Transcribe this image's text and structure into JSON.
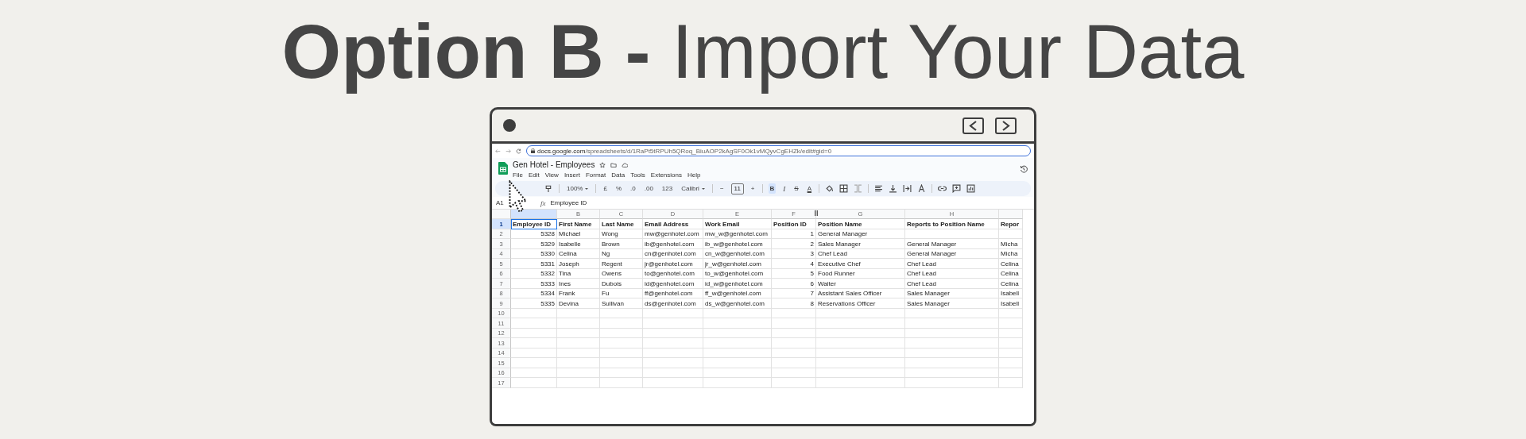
{
  "title": "**Option B -** Import Your Data",
  "browser": {
    "url_host": "docs.google.com",
    "url_path": "/spreadsheets/d/1RaPt5tRPUh5QRoq_BiuAOP2kAgSF0Ok1vMQyvCgEHZk/edit#gid=0"
  },
  "sheet": {
    "title": "Gen Hotel - Employees",
    "menus": [
      "File",
      "Edit",
      "View",
      "Insert",
      "Format",
      "Data",
      "Tools",
      "Extensions",
      "Help"
    ],
    "toolbar": [
      {
        "kind": "dropdown",
        "label": "100%"
      },
      {
        "kind": "text",
        "label": "£"
      },
      {
        "kind": "text",
        "label": "%"
      },
      {
        "kind": "text",
        "label": ".0"
      },
      {
        "kind": "text",
        "label": ".00"
      },
      {
        "kind": "text",
        "label": "123"
      },
      {
        "kind": "dropdown",
        "label": "Calibri"
      },
      {
        "kind": "stepper",
        "minus": "−",
        "value": "11",
        "plus": "+"
      },
      {
        "kind": "bold",
        "label": "B",
        "selected": true
      },
      {
        "kind": "italic",
        "label": "I",
        "selected": false
      },
      {
        "kind": "strike",
        "label": "S",
        "selected": false
      },
      {
        "kind": "underline",
        "label": "A",
        "selected": false
      }
    ],
    "formula": {
      "fx": "fx",
      "cell": "A1",
      "value": "Employee ID"
    },
    "columns": [
      {
        "kind": "number",
        "selected": true
      },
      {
        "letter": "B",
        "kind": "text",
        "selected": false
      },
      {
        "letter": "C",
        "kind": "text",
        "selected": false
      },
      {
        "letter": "D",
        "kind": "text",
        "selected": false
      },
      {
        "letter": "E",
        "kind": "text",
        "selected": false
      },
      {
        "letter": "F",
        "kind": "number",
        "selected": false
      },
      {
        "letter": "G",
        "kind": "text",
        "selected": false
      },
      {
        "letter": "H",
        "kind": "text",
        "selected": false
      },
      {
        "kind": "text",
        "selected": false
      }
    ],
    "rows": [
      {
        "number": "1",
        "selected": true,
        "cells": [
          "Employee ID",
          "First Name",
          "Last Name",
          "Email Address",
          "Work Email",
          "Position ID",
          "Position Name",
          "Reports to Position Name",
          "Repor"
        ]
      },
      {
        "number": "2",
        "selected": false,
        "cells": [
          "5328",
          "Michael",
          "Wong",
          "mw@genhotel.com",
          "mw_w@genhotel.com",
          "1",
          "General Manager"
        ]
      },
      {
        "number": "3",
        "selected": false,
        "cells": [
          "5329",
          "Isabelle",
          "Brown",
          "ib@genhotel.com",
          "ib_w@genhotel.com",
          "2",
          "Sales Manager",
          "General Manager",
          "Micha"
        ]
      },
      {
        "number": "4",
        "selected": false,
        "cells": [
          "5330",
          "Celina",
          "Ng",
          "cn@genhotel.com",
          "cn_w@genhotel.com",
          "3",
          "Chef Lead",
          "General Manager",
          "Micha"
        ]
      },
      {
        "number": "5",
        "selected": false,
        "cells": [
          "5331",
          "Joseph",
          "Regent",
          "jr@genhotel.com",
          "jr_w@genhotel.com",
          "4",
          "Executive Chef",
          "Chef Lead",
          "Celina"
        ]
      },
      {
        "number": "6",
        "selected": false,
        "cells": [
          "5332",
          "Tina",
          "Owens",
          "to@genhotel.com",
          "to_w@genhotel.com",
          "5",
          "Food Runner",
          "Chef Lead",
          "Celina"
        ]
      },
      {
        "number": "7",
        "selected": false,
        "cells": [
          "5333",
          "Ines",
          "Dubois",
          "id@genhotel.com",
          "id_w@genhotel.com",
          "6",
          "Waiter",
          "Chef Lead",
          "Celina"
        ]
      },
      {
        "number": "8",
        "selected": false,
        "cells": [
          "5334",
          "Frank",
          "Fu",
          "ff@genhotel.com",
          "ff_w@genhotel.com",
          "7",
          "Assistant Sales Officer",
          "Sales Manager",
          "Isabell"
        ]
      },
      {
        "number": "9",
        "selected": false,
        "cells": [
          "5335",
          "Devina",
          "Sullivan",
          "ds@genhotel.com",
          "ds_w@genhotel.com",
          "8",
          "Reservations Officer",
          "Sales Manager",
          "Isabell"
        ]
      },
      {
        "number": "10",
        "selected": false
      },
      {
        "number": "11",
        "selected": false
      },
      {
        "number": "12",
        "selected": false
      },
      {
        "number": "13",
        "selected": false
      },
      {
        "number": "14",
        "selected": false
      },
      {
        "number": "15",
        "selected": false
      },
      {
        "number": "16",
        "selected": false
      },
      {
        "number": "17",
        "selected": false
      }
    ]
  }
}
